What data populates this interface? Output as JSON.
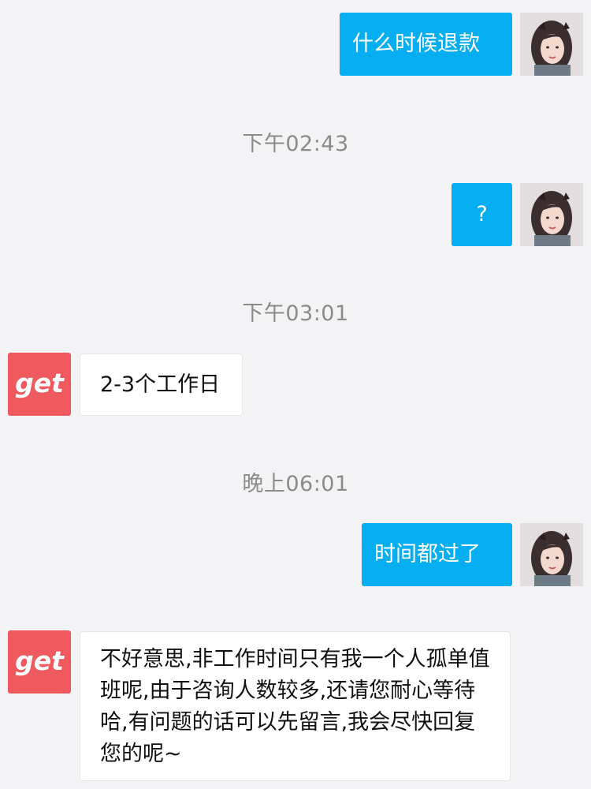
{
  "chat": {
    "messages": [
      {
        "sender": "user",
        "avatar_icon": "user-avatar-photo",
        "text": "什么时候退款"
      },
      {
        "timestamp": "下午02:43"
      },
      {
        "sender": "user",
        "avatar_icon": "user-avatar-photo",
        "text": "?"
      },
      {
        "timestamp": "下午03:01"
      },
      {
        "sender": "agent",
        "avatar_icon": "get-logo",
        "avatar_text": "get",
        "text": "2-3个工作日"
      },
      {
        "timestamp": "晚上06:01"
      },
      {
        "sender": "user",
        "avatar_icon": "user-avatar-photo",
        "text": "时间都过了"
      },
      {
        "sender": "agent",
        "avatar_icon": "get-logo",
        "avatar_text": "get",
        "text": "不好意思,非工作时间只有我一个人孤单值班呢,由于咨询人数较多,还请您耐心等待哈,有问题的话可以先留言,我会尽快回复您的呢~"
      }
    ]
  },
  "colors": {
    "background": "#f3f3f6",
    "user_bubble": "#05aef1",
    "agent_bubble": "#ffffff",
    "get_logo": "#f05a5e",
    "timestamp_text": "#8b8b8b"
  }
}
